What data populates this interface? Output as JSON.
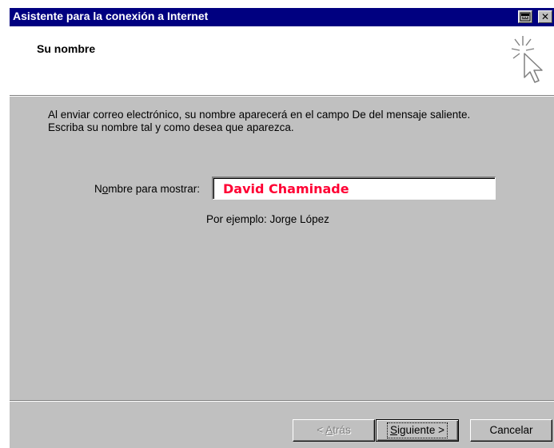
{
  "window": {
    "title": "Asistente para la conexión a Internet"
  },
  "header": {
    "title": "Su nombre"
  },
  "body": {
    "description": "Al enviar correo electrónico, su nombre aparecerá en el campo De del mensaje saliente. Escriba su nombre tal y como desea que aparezca.",
    "display_name_label_pre": "N",
    "display_name_label_underlined": "o",
    "display_name_label_post": "mbre para mostrar:",
    "display_name_value": "David Chaminade",
    "example": "Por ejemplo: Jorge López"
  },
  "buttons": {
    "back_pre": "< ",
    "back_underlined": "A",
    "back_post": "trás",
    "next_underlined": "S",
    "next_post": "iguiente >",
    "cancel": "Cancelar"
  },
  "colors": {
    "titlebar": "#000080",
    "window_face": "#c0c0c0",
    "name_text": "#ff0033"
  },
  "icons": {
    "titlebar_button_1": "keyboard-icon",
    "titlebar_button_2": "close-icon",
    "wizard": "wizard-cursor-sparkle-icon"
  }
}
